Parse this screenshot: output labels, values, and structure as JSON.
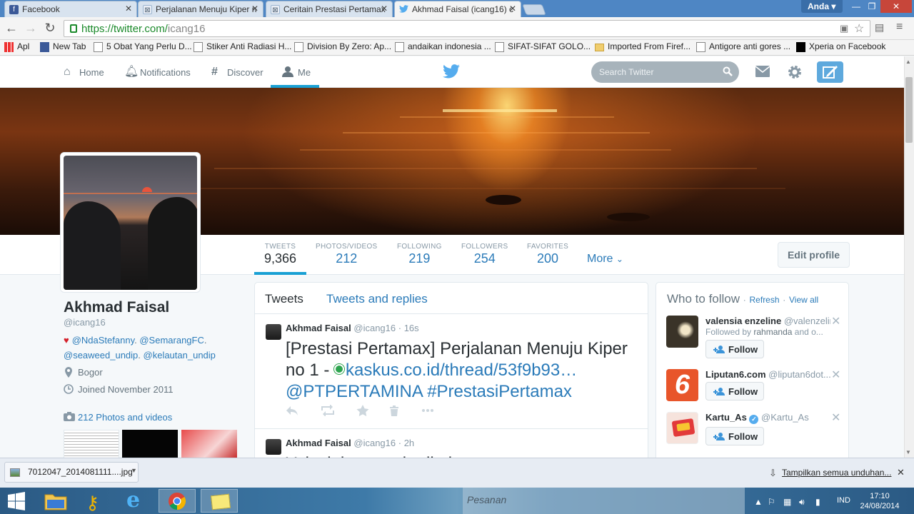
{
  "browser": {
    "tabs": [
      {
        "title": "Facebook",
        "icon": "facebook-icon"
      },
      {
        "title": "Perjalanan Menuju Kiper n",
        "icon": "kaskus-icon"
      },
      {
        "title": "Ceritain Prestasi Pertamax",
        "icon": "kaskus-icon"
      },
      {
        "title": "Akhmad Faisal (icang16) c",
        "icon": "twitter-icon"
      }
    ],
    "profile_button": "Anda",
    "url_host": "https://twitter.com/",
    "url_path": "icang16",
    "bookmarks": [
      {
        "label": "Apl",
        "icon": "apps-icon"
      },
      {
        "label": "New Tab",
        "icon": "facebook-icon"
      },
      {
        "label": "5 Obat Yang Perlu D...",
        "icon": "page-icon"
      },
      {
        "label": "Stiker Anti Radiasi H...",
        "icon": "page-icon"
      },
      {
        "label": "Division By Zero: Ap...",
        "icon": "page-icon"
      },
      {
        "label": "andaikan indonesia ...",
        "icon": "page-icon"
      },
      {
        "label": "SIFAT-SIFAT GOLO...",
        "icon": "page-icon"
      },
      {
        "label": "Imported From Firef...",
        "icon": "folder-icon"
      },
      {
        "label": "Antigore anti gores ...",
        "icon": "page-icon"
      },
      {
        "label": "Xperia on Facebook",
        "icon": "xperia-icon"
      }
    ]
  },
  "twitter": {
    "nav": {
      "home": "Home",
      "notifications": "Notifications",
      "discover": "Discover",
      "me": "Me"
    },
    "search_placeholder": "Search Twitter",
    "stats": [
      {
        "label": "TWEETS",
        "value": "9,366"
      },
      {
        "label": "PHOTOS/VIDEOS",
        "value": "212"
      },
      {
        "label": "FOLLOWING",
        "value": "219"
      },
      {
        "label": "FOLLOWERS",
        "value": "254"
      },
      {
        "label": "FAVORITES",
        "value": "200"
      }
    ],
    "more": "More",
    "edit_profile": "Edit profile",
    "profile": {
      "name": "Akhmad Faisal",
      "handle": "@icang16",
      "bio_links": [
        "@NdaStefanny",
        "@SemarangFC",
        "@seaweed_undip",
        "@kelautan_undip"
      ],
      "location": "Bogor",
      "joined": "Joined November 2011",
      "photos_link": "212 Photos and videos"
    },
    "timeline_tabs": {
      "tweets": "Tweets",
      "replies": "Tweets and replies"
    },
    "tweets": [
      {
        "name": "Akhmad Faisal",
        "handle": "@icang16",
        "time": "16s",
        "text_prefix": "[Prestasi Pertamax] Perjalanan Menuju Kiper no 1 - ",
        "link": "kaskus.co.id/thread/53f9b93…",
        "mention": "@PTPERTAMINA",
        "hashtag": "#PrestasiPertamax"
      },
      {
        "name": "Akhmad Faisal",
        "handle": "@icang16",
        "time": "2h",
        "text_prefix": "Yaiyalah ngapain dia ke ...",
        "link": "",
        "mention": "",
        "hashtag": ""
      }
    ],
    "who_to_follow": {
      "title": "Who to follow",
      "refresh": "Refresh",
      "view_all": "View all",
      "suggestions": [
        {
          "name": "valensia enzeline",
          "handle": "@valenzelin",
          "sub_prefix": "Followed by",
          "sub_user": "rahmanda",
          "sub_suffix": "and o...",
          "follow": "Follow"
        },
        {
          "name": "Liputan6.com",
          "handle": "@liputan6dot...",
          "sub_prefix": "",
          "sub_user": "",
          "sub_suffix": "",
          "follow": "Follow"
        },
        {
          "name": "Kartu_As",
          "handle": "@Kartu_As",
          "sub_prefix": "",
          "sub_user": "",
          "sub_suffix": "",
          "follow": "Follow",
          "verified": true
        }
      ]
    }
  },
  "downloads": {
    "file": "7012047_2014081111....jpg",
    "show_all": "Tampilkan semua unduhan..."
  },
  "taskbar": {
    "message_box": "Pesanan",
    "language": "IND",
    "time": "17:10",
    "date": "24/08/2014"
  },
  "colors": {
    "twitter_blue": "#2b7bb9",
    "accent": "#19a0d4",
    "chrome_blue": "#4e86c4"
  }
}
